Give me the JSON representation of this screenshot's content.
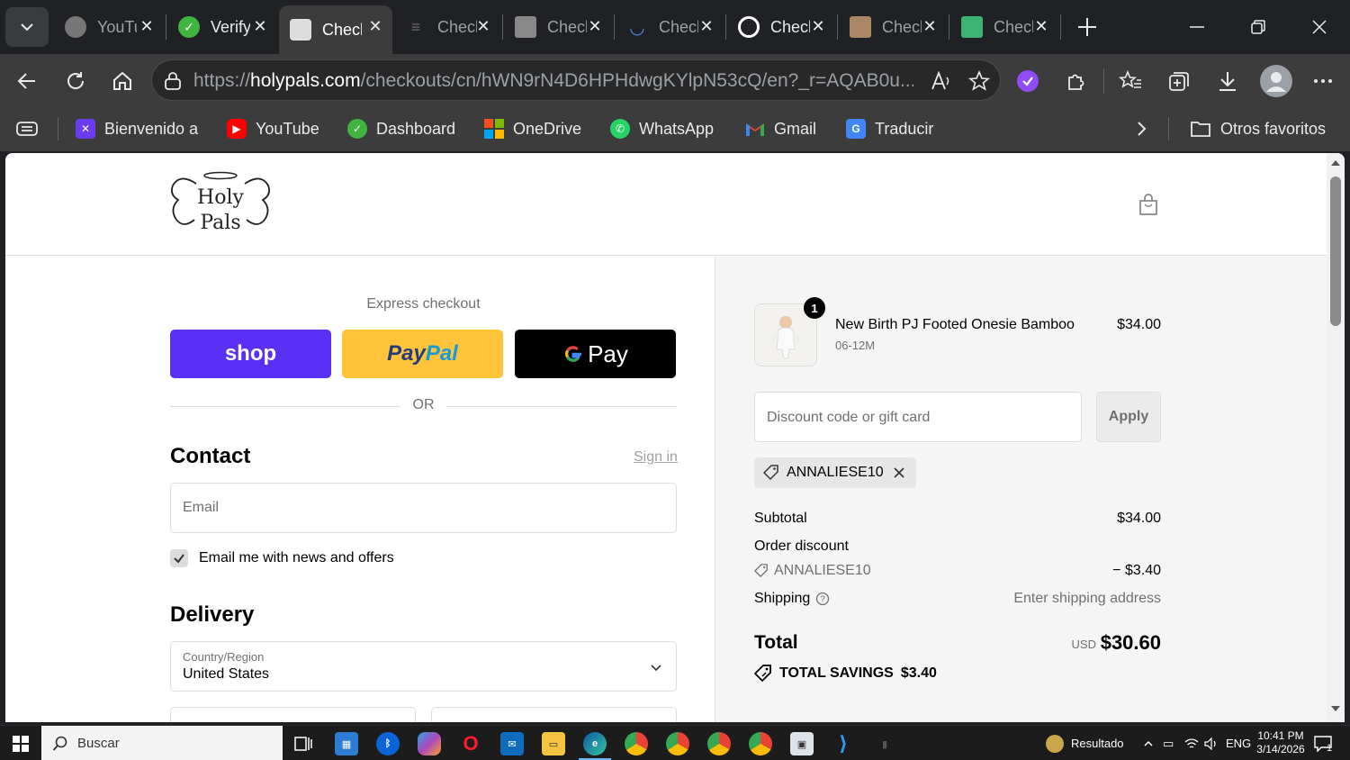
{
  "browser": {
    "tabs": [
      {
        "title": "YouTube",
        "icon": "youtube-icon",
        "color": "#777777"
      },
      {
        "title": "Verify",
        "icon": "verify-icon",
        "color": "#3fb43f"
      },
      {
        "title": "Checkout",
        "icon": "holypals-icon",
        "color": "#dddddd",
        "active": true
      },
      {
        "title": "Checkout",
        "icon": "list-icon",
        "color": "#666666"
      },
      {
        "title": "Checkout",
        "icon": "figure-icon",
        "color": "#888888"
      },
      {
        "title": "Checkout",
        "icon": "tub-icon",
        "color": "#4a90e2"
      },
      {
        "title": "Checkout",
        "icon": "ring-icon",
        "color": "#ffffff"
      },
      {
        "title": "Checkout",
        "icon": "person-icon",
        "color": "#aa8866"
      },
      {
        "title": "Checkout",
        "icon": "pattern-icon",
        "color": "#3cb371"
      }
    ],
    "url_prefix": "https://",
    "url_host": "holypals.com",
    "url_path": "/checkouts/cn/hWN9rN4D6HPHdwgKYlpN53cQ/en?_r=AQAB0u..."
  },
  "bookmarks": {
    "items": [
      {
        "label": "Bienvenido a",
        "icon": "bienvenido-icon",
        "color": "#6a3cf0"
      },
      {
        "label": "YouTube",
        "icon": "youtube-icon",
        "color": "#ff0000"
      },
      {
        "label": "Dashboard",
        "icon": "dashboard-icon",
        "color": "#3fb43f"
      },
      {
        "label": "OneDrive",
        "icon": "microsoft-icon",
        "color": "#f25022"
      },
      {
        "label": "WhatsApp",
        "icon": "whatsapp-icon",
        "color": "#25d366"
      },
      {
        "label": "Gmail",
        "icon": "gmail-icon",
        "color": "#ea4335"
      },
      {
        "label": "Traducir",
        "icon": "translate-icon",
        "color": "#4285f4"
      }
    ],
    "other": "Otros favoritos"
  },
  "checkout": {
    "express_label": "Express checkout",
    "shop_label": "shop",
    "paypal_label_1": "Pay",
    "paypal_label_2": "Pal",
    "gpay_label": "Pay",
    "or_label": "OR",
    "contact_heading": "Contact",
    "sign_in": "Sign in",
    "email_placeholder": "Email",
    "news_label": "Email me with news and offers",
    "news_checked": true,
    "delivery_heading": "Delivery",
    "country_label": "Country/Region",
    "country_value": "United States"
  },
  "summary": {
    "product": {
      "name": "New Birth PJ Footed Onesie Bamboo",
      "variant": "06-12M",
      "price": "$34.00",
      "quantity": "1"
    },
    "discount_placeholder": "Discount code or gift card",
    "apply_label": "Apply",
    "applied_code": "ANNALIESE10",
    "subtotal_label": "Subtotal",
    "subtotal_value": "$34.00",
    "order_discount_label": "Order discount",
    "discount_code": "ANNALIESE10",
    "discount_value": "− $3.40",
    "shipping_label": "Shipping",
    "shipping_value": "Enter shipping address",
    "total_label": "Total",
    "currency": "USD",
    "total_value": "$30.60",
    "savings_label": "TOTAL SAVINGS",
    "savings_value": "$3.40"
  },
  "taskbar": {
    "search_placeholder": "Buscar",
    "tray_label": "Resultado",
    "lang": "ENG",
    "time": "10:41 PM",
    "date": "3/14/2026",
    "notifications": "1"
  }
}
